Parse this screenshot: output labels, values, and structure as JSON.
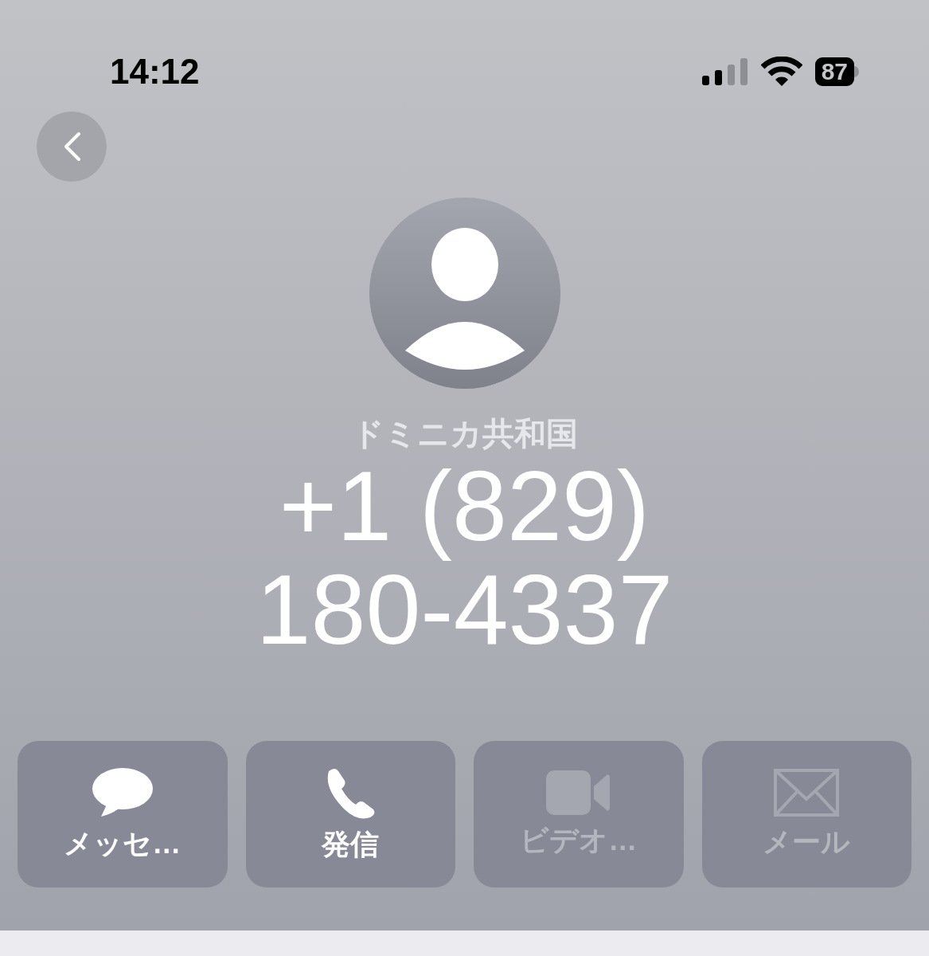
{
  "status_bar": {
    "time": "14:12",
    "battery": "87"
  },
  "contact": {
    "country": "ドミニカ共和国",
    "number_lines": [
      "+1 (829)",
      "180-4337"
    ]
  },
  "actions": [
    {
      "kind": "message",
      "label": "メッセ…",
      "disabled": false
    },
    {
      "kind": "call",
      "label": "発信",
      "disabled": false
    },
    {
      "kind": "video",
      "label": "ビデオ…",
      "disabled": true
    },
    {
      "kind": "mail",
      "label": "メール",
      "disabled": true
    }
  ]
}
